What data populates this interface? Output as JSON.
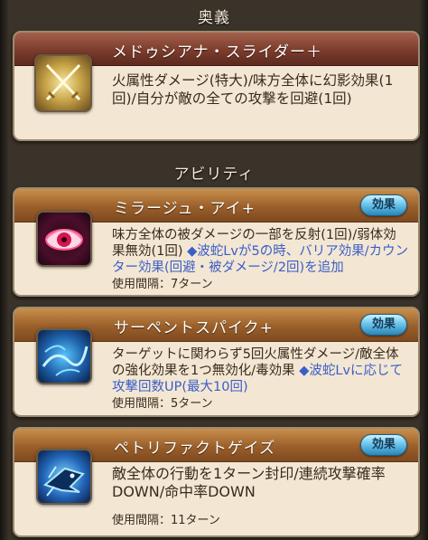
{
  "sections": {
    "ougi_label": "奥義",
    "ability_label": "アビリティ"
  },
  "ougi": {
    "name": "メドゥシアナ・スライダー＋",
    "description": "火属性ダメージ(特大)/味方全体に幻影効果(1回)/自分が敵の全ての攻撃を回避(1回)",
    "icon": "crossed-swords-icon"
  },
  "abilities": [
    {
      "name": "ミラージュ・アイ+",
      "effect_label": "効果",
      "description": "味方全体の被ダメージの一部を反射(1回)/弱体効果無効(1回)",
      "note": "◆波蛇Lvが5の時、バリア効果/カウンター効果(回避・被ダメージ/2回)を追加",
      "interval": "使用間隔：7ターン",
      "icon": "red-eye-icon"
    },
    {
      "name": "サーペントスパイク+",
      "effect_label": "効果",
      "description": "ターゲットに関わらず5回火属性ダメージ/敵全体の強化効果を1つ無効化/毒効果",
      "note": "◆波蛇Lvに応じて攻撃回数UP(最大10回)",
      "interval": "使用間隔：5ターン",
      "icon": "serpent-spike-icon"
    },
    {
      "name": "ペトリファクトゲイズ",
      "effect_label": "効果",
      "description": "敵全体の行動を1ターン封印/連続攻撃確率DOWN/命中率DOWN",
      "note": "",
      "interval": "使用間隔：11ターン",
      "icon": "serpent-gaze-icon"
    }
  ],
  "colors": {
    "card_bg": "#f3e7d3",
    "note_text": "#3b5dc9",
    "effect_button": "#6cc5ea"
  }
}
